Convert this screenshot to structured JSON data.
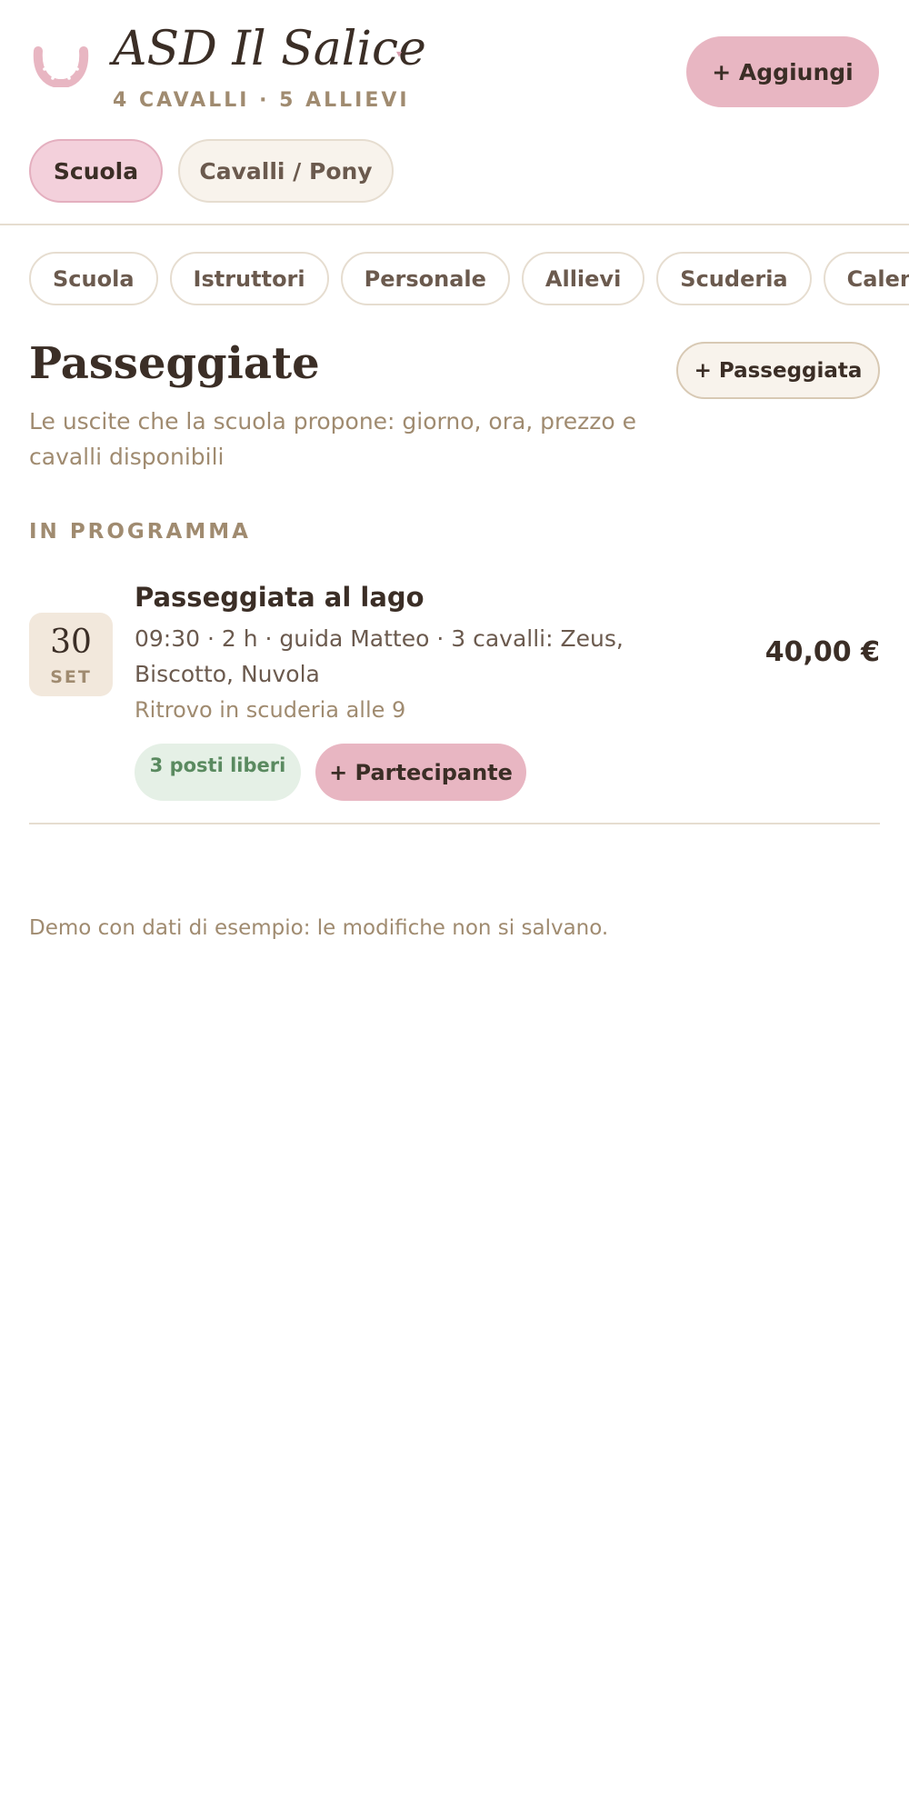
{
  "header": {
    "club_name": "ASD Il Salice",
    "club_caret": "▾",
    "club_summary": "4 CAVALLI · 5 ALLIEVI",
    "add_button": "+ Aggiungi",
    "logo_icon": "horseshoe-icon",
    "accent_color": "#e8b6c2"
  },
  "segments": {
    "active": "Scuola",
    "inactive": "Cavalli / Pony"
  },
  "tabs": [
    "Scuola",
    "Istruttori",
    "Personale",
    "Allievi",
    "Scuderia",
    "Calendario"
  ],
  "page": {
    "title": "Passeggiate",
    "description": "Le uscite che la scuola propone: giorno, ora, prezzo e cavalli disponibili",
    "add_button": "+ Passeggiata"
  },
  "section": {
    "label": "IN PROGRAMMA"
  },
  "event": {
    "day": "30",
    "month": "SET",
    "title": "Passeggiata al lago",
    "meta": "09:30 · 2 h · guida Matteo · 3 cavalli: Zeus, Biscotto, Nuvola",
    "note": "Ritrovo in scuderia alle 9",
    "price": "40,00 €",
    "availability": "3 posti liberi",
    "add_participant": "+ Partecipante",
    "availability_color": "#5a8a60"
  },
  "footer": {
    "demo_note": "Demo con dati di esempio: le modifiche non si salvano."
  }
}
